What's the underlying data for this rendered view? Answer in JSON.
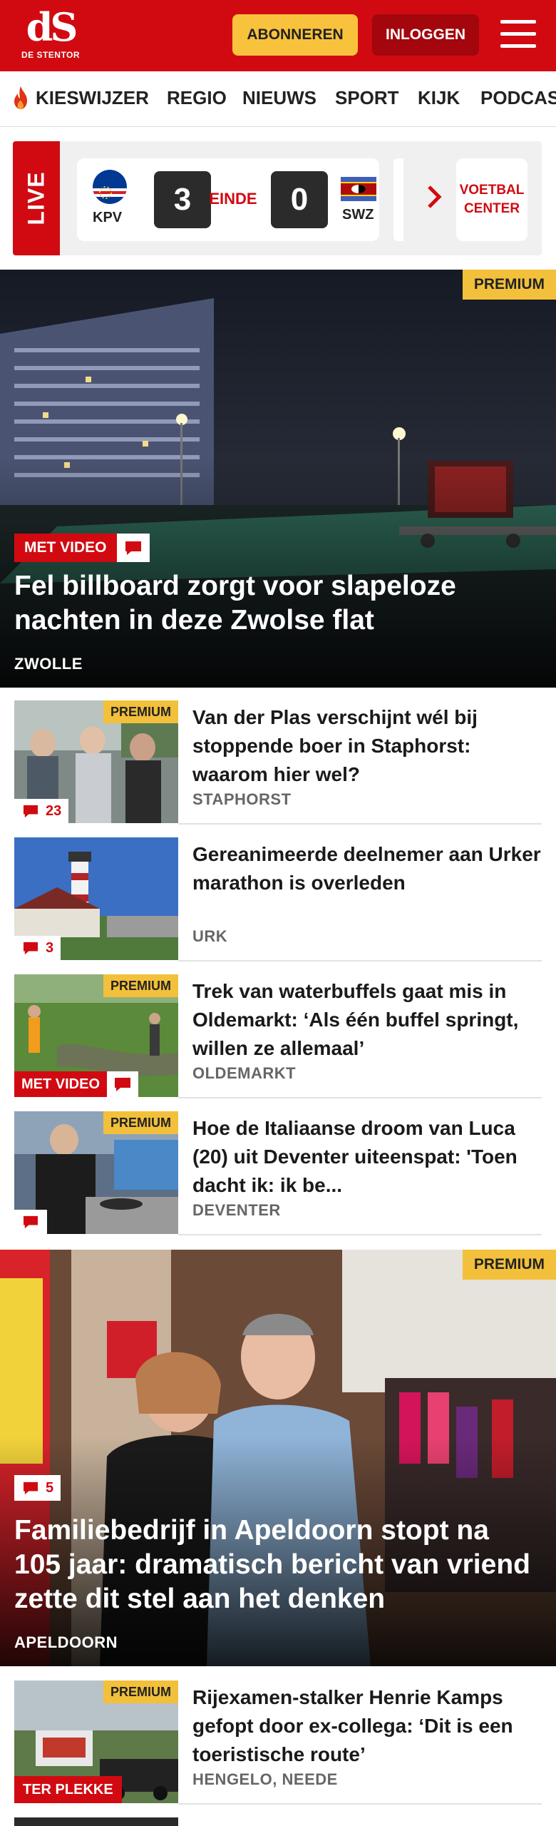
{
  "header": {
    "logo_mark": "dS",
    "logo_name": "DE STENTOR",
    "subscribe_label": "ABONNEREN",
    "login_label": "INLOGGEN",
    "brand_color": "#d10a11",
    "subscribe_color": "#f9c23c"
  },
  "nav": {
    "items": [
      "KIESWIJZER",
      "REGIO",
      "NIEUWS",
      "SPORT",
      "KIJK",
      "PODCAS"
    ]
  },
  "live": {
    "label": "LIVE",
    "home_code": "KPV",
    "away_code": "SWZ",
    "home_score": "3",
    "away_score": "0",
    "status": "EINDE",
    "center_label_1": "VOETBAL",
    "center_label_2": "CENTER"
  },
  "hero1": {
    "badge": "PREMIUM",
    "video_label": "MET VIDEO",
    "title": "Fel billboard zorgt voor slapeloze nachten in deze Zwolse flat",
    "location": "ZWOLLE"
  },
  "articles": [
    {
      "title": "Van der Plas verschijnt wél bij stoppende boer in Staphorst: waarom hier wel?",
      "location": "STAPHORST",
      "premium": "PREMIUM",
      "comments": "23"
    },
    {
      "title": "Gereanimeerde deelnemer aan Urker marathon is overleden",
      "location": "URK",
      "comments": "3"
    },
    {
      "title": "Trek van waterbuffels gaat mis in Oldemarkt: ‘Als één buffel springt, willen ze allemaal’",
      "location": "OLDEMARKT",
      "premium": "PREMIUM",
      "video_label": "MET VIDEO"
    },
    {
      "title": "Hoe de Italiaanse droom van Luca (20) uit Deventer uiteenspat: 'Toen dacht ik: ik be...",
      "location": "DEVENTER",
      "premium": "PREMIUM"
    }
  ],
  "hero2": {
    "badge": "PREMIUM",
    "comments": "5",
    "title": "Familiebedrijf in Apeldoorn stopt na 105 jaar: dramatisch bericht van vriend zette dit stel aan het denken",
    "location": "APELDOORN"
  },
  "article_last": {
    "title": "Rijexamen-stalker Henrie Kamps gefopt door ex-collega: ‘Dit is een toeristische route’",
    "location": "HENGELO, NEEDE",
    "premium": "PREMIUM",
    "tag": "TER PLEKKE"
  }
}
